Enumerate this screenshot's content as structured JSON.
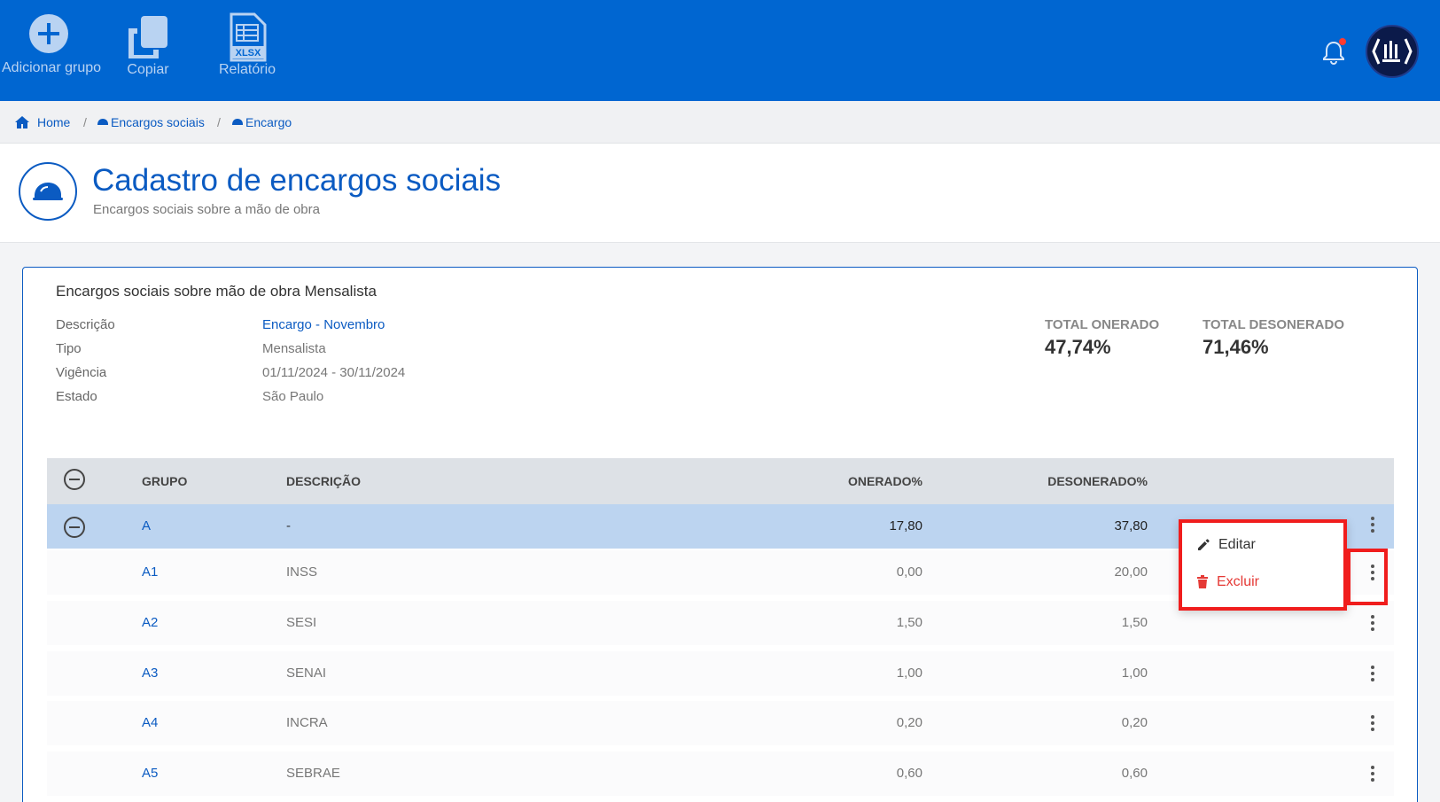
{
  "toolbar": {
    "add_group": {
      "label": "Adicionar grupo",
      "icon": "plus-circle-icon"
    },
    "copy": {
      "label": "Copiar",
      "icon": "copy-icon"
    },
    "report": {
      "label": "Relatório",
      "icon": "xlsx-file-icon",
      "badge": "XLSX"
    },
    "notification_icon": "bell-icon",
    "avatar_icon": "company-logo"
  },
  "breadcrumb": {
    "home": "Home",
    "level1": "Encargos sociais",
    "level2": "Encargo",
    "separator": "/"
  },
  "header": {
    "title": "Cadastro de encargos sociais",
    "subtitle": "Encargos sociais sobre a mão de obra",
    "icon": "helmet-icon"
  },
  "card": {
    "title": "Encargos sociais sobre mão de obra Mensalista",
    "fields": [
      {
        "label": "Descrição",
        "value": "Encargo - Novembro"
      },
      {
        "label": "Tipo",
        "value": "Mensalista"
      },
      {
        "label": "Vigência",
        "value": "01/11/2024 - 30/11/2024"
      },
      {
        "label": "Estado",
        "value": "São Paulo"
      }
    ],
    "totals": [
      {
        "label": "TOTAL ONERADO",
        "value": "47,74%"
      },
      {
        "label": "TOTAL DESONERADO",
        "value": "71,46%"
      }
    ]
  },
  "table": {
    "headers": {
      "grupo": "GRUPO",
      "descricao": "DESCRIÇÃO",
      "onerado": "ONERADO%",
      "desonerado": "DESONERADO%"
    },
    "rows": [
      {
        "code": "A",
        "desc": "-",
        "onerado": "17,80",
        "desonerado": "37,80"
      },
      {
        "code": "A1",
        "desc": "INSS",
        "onerado": "0,00",
        "desonerado": "20,00"
      },
      {
        "code": "A2",
        "desc": "SESI",
        "onerado": "1,50",
        "desonerado": "1,50"
      },
      {
        "code": "A3",
        "desc": "SENAI",
        "onerado": "1,00",
        "desonerado": "1,00"
      },
      {
        "code": "A4",
        "desc": "INCRA",
        "onerado": "0,20",
        "desonerado": "0,20"
      },
      {
        "code": "A5",
        "desc": "SEBRAE",
        "onerado": "0,60",
        "desonerado": "0,60"
      }
    ]
  },
  "context_menu": {
    "edit": "Editar",
    "delete": "Excluir"
  },
  "colors": {
    "primary": "#0066d1",
    "link": "#0b5bc2",
    "group_row": "#bcd4f0",
    "danger": "#e53935",
    "highlight": "#f01d1d"
  }
}
